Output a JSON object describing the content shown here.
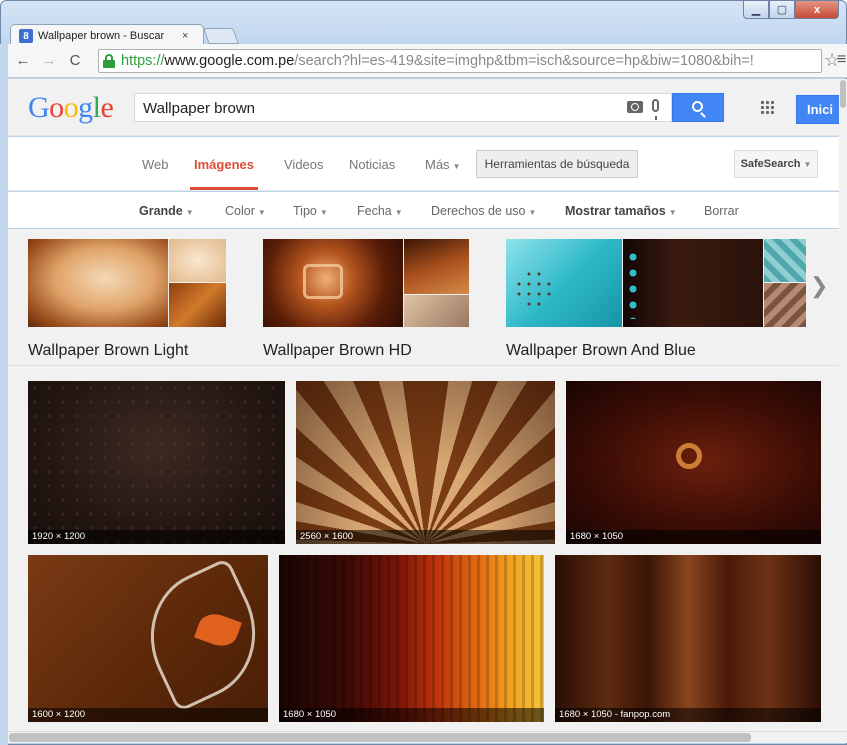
{
  "browser": {
    "tab_title": "Wallpaper brown - Buscar",
    "tab_close": "×",
    "favicon": "8",
    "url_scheme": "https://",
    "url_host": "www.google.com.pe",
    "url_rest": "/search?hl=es-419&site=imghp&tbm=isch&source=hp&biw=1080&bih=!",
    "controls": {
      "minimize": "▁",
      "maximize": "▢",
      "close": "x"
    }
  },
  "google": {
    "logo": "Google",
    "query": "Wallpaper brown",
    "signin_label": "Inici"
  },
  "nav": {
    "web": "Web",
    "images": "Imágenes",
    "videos": "Videos",
    "news": "Noticias",
    "more": "Más",
    "tools": "Herramientas de búsqueda",
    "safesearch": "SafeSearch"
  },
  "filters": {
    "size": "Grande",
    "color": "Color",
    "type": "Tipo",
    "date": "Fecha",
    "rights": "Derechos de uso",
    "show_sizes": "Mostrar tamaños",
    "clear": "Borrar"
  },
  "related": [
    {
      "label": "Wallpaper Brown Light"
    },
    {
      "label": "Wallpaper Brown HD"
    },
    {
      "label": "Wallpaper Brown And Blue"
    }
  ],
  "images": [
    {
      "dims": "1920 × 1200"
    },
    {
      "dims": "2560 × 1600"
    },
    {
      "dims": "1680 × 1050"
    },
    {
      "dims": "1600 × 1200"
    },
    {
      "dims": "1680 × 1050"
    },
    {
      "dims": "1680 × 1050 - fanpop.com"
    }
  ],
  "icons": [
    "lock-icon",
    "back-icon",
    "forward-icon",
    "reload-icon",
    "star-icon",
    "menu-icon",
    "camera-icon",
    "mic-icon",
    "search-icon",
    "apps-icon",
    "chevron-right-icon"
  ],
  "colors": {
    "accent_red": "#dd4b39",
    "accent_blue": "#4285f4",
    "url_green": "#2e9e3c"
  }
}
